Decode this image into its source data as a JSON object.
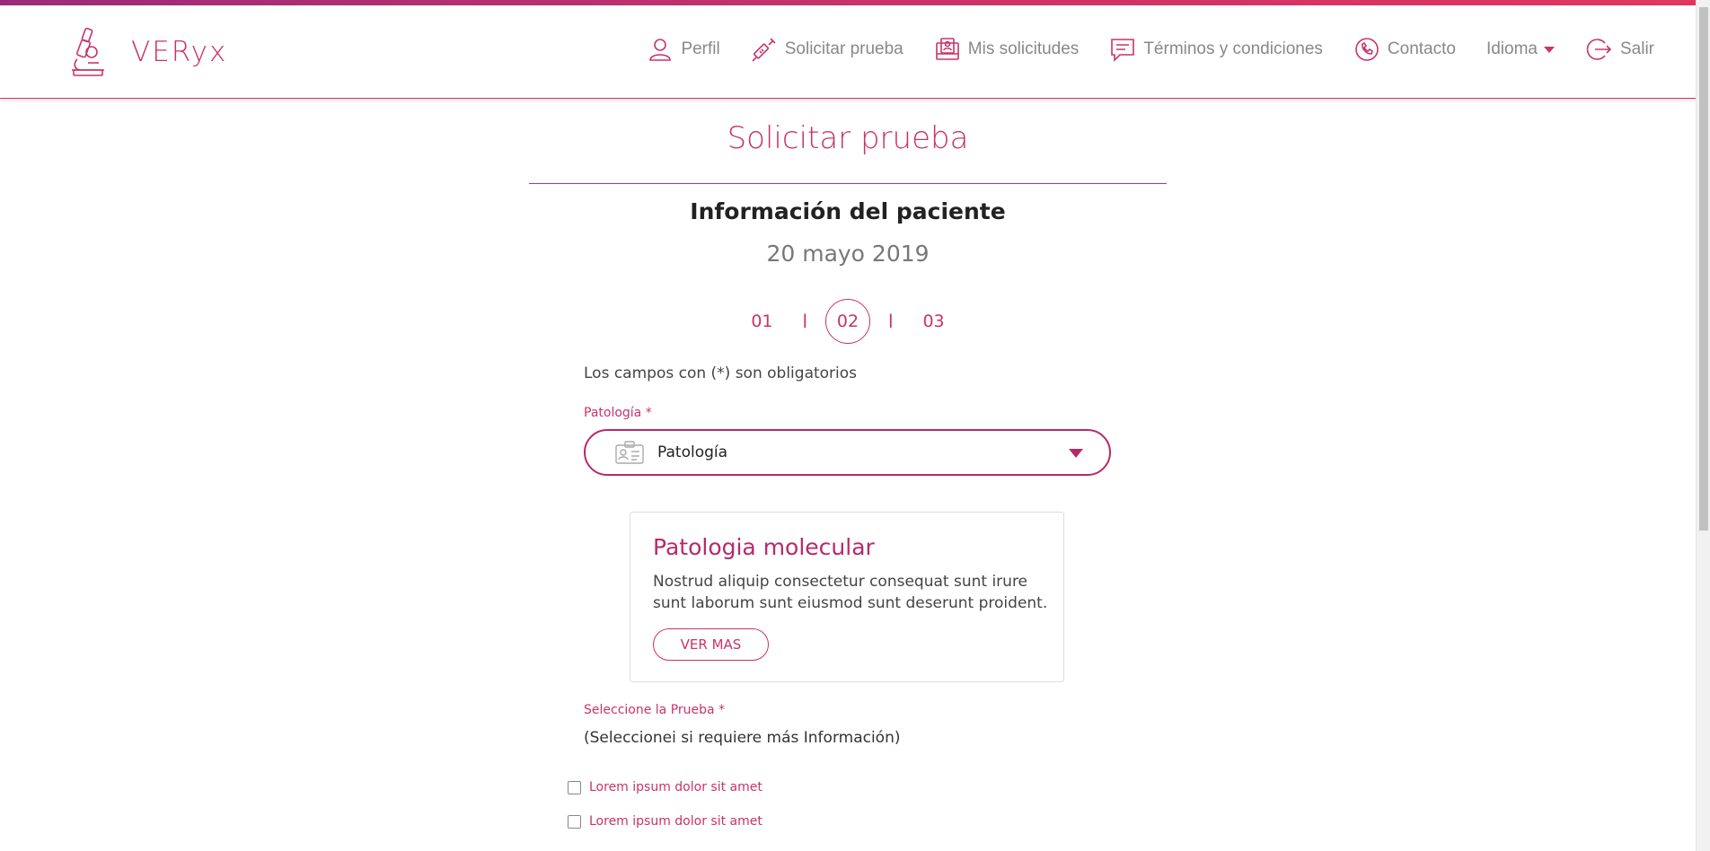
{
  "brand": {
    "name": "VERyx"
  },
  "nav": {
    "items": [
      {
        "label": "Perfil",
        "icon": "user-icon"
      },
      {
        "label": "Solicitar prueba",
        "icon": "syringe-icon"
      },
      {
        "label": "Mis solicitudes",
        "icon": "folder-icon"
      },
      {
        "label": "Términos y condiciones",
        "icon": "chat-icon"
      },
      {
        "label": "Contacto",
        "icon": "phone-icon"
      },
      {
        "label": "Idioma",
        "icon": "chevron-down-icon"
      },
      {
        "label": "Salir",
        "icon": "logout-icon"
      }
    ]
  },
  "page": {
    "title": "Solicitar prueba",
    "section_title": "Información del paciente",
    "date": "20 mayo 2019"
  },
  "stepper": {
    "steps": [
      "01",
      "02",
      "03"
    ],
    "separator": "l",
    "active_step": "02"
  },
  "form": {
    "required_note": "Los campos con (*) son obligatorios",
    "pathology_label": "Patología *",
    "pathology_value": "Patología",
    "test_label": "Seleccione la Prueba *",
    "test_hint": "(Seleccionei si requiere más Información)",
    "options": [
      {
        "label": "Lorem ipsum dolor sit amet",
        "checked": false
      },
      {
        "label": "Lorem ipsum dolor sit amet",
        "checked": false
      }
    ]
  },
  "card": {
    "title": "Patologia molecular",
    "text": "Nostrud aliquip consectetur consequat sunt irure sunt laborum sunt eiusmod sunt deserunt proident.",
    "button_label": "VER MAS"
  },
  "colors": {
    "accent": "#c8336a",
    "accent_dark": "#b8296a",
    "gradient_start": "#9b2b7a",
    "gradient_end": "#e2365f"
  }
}
